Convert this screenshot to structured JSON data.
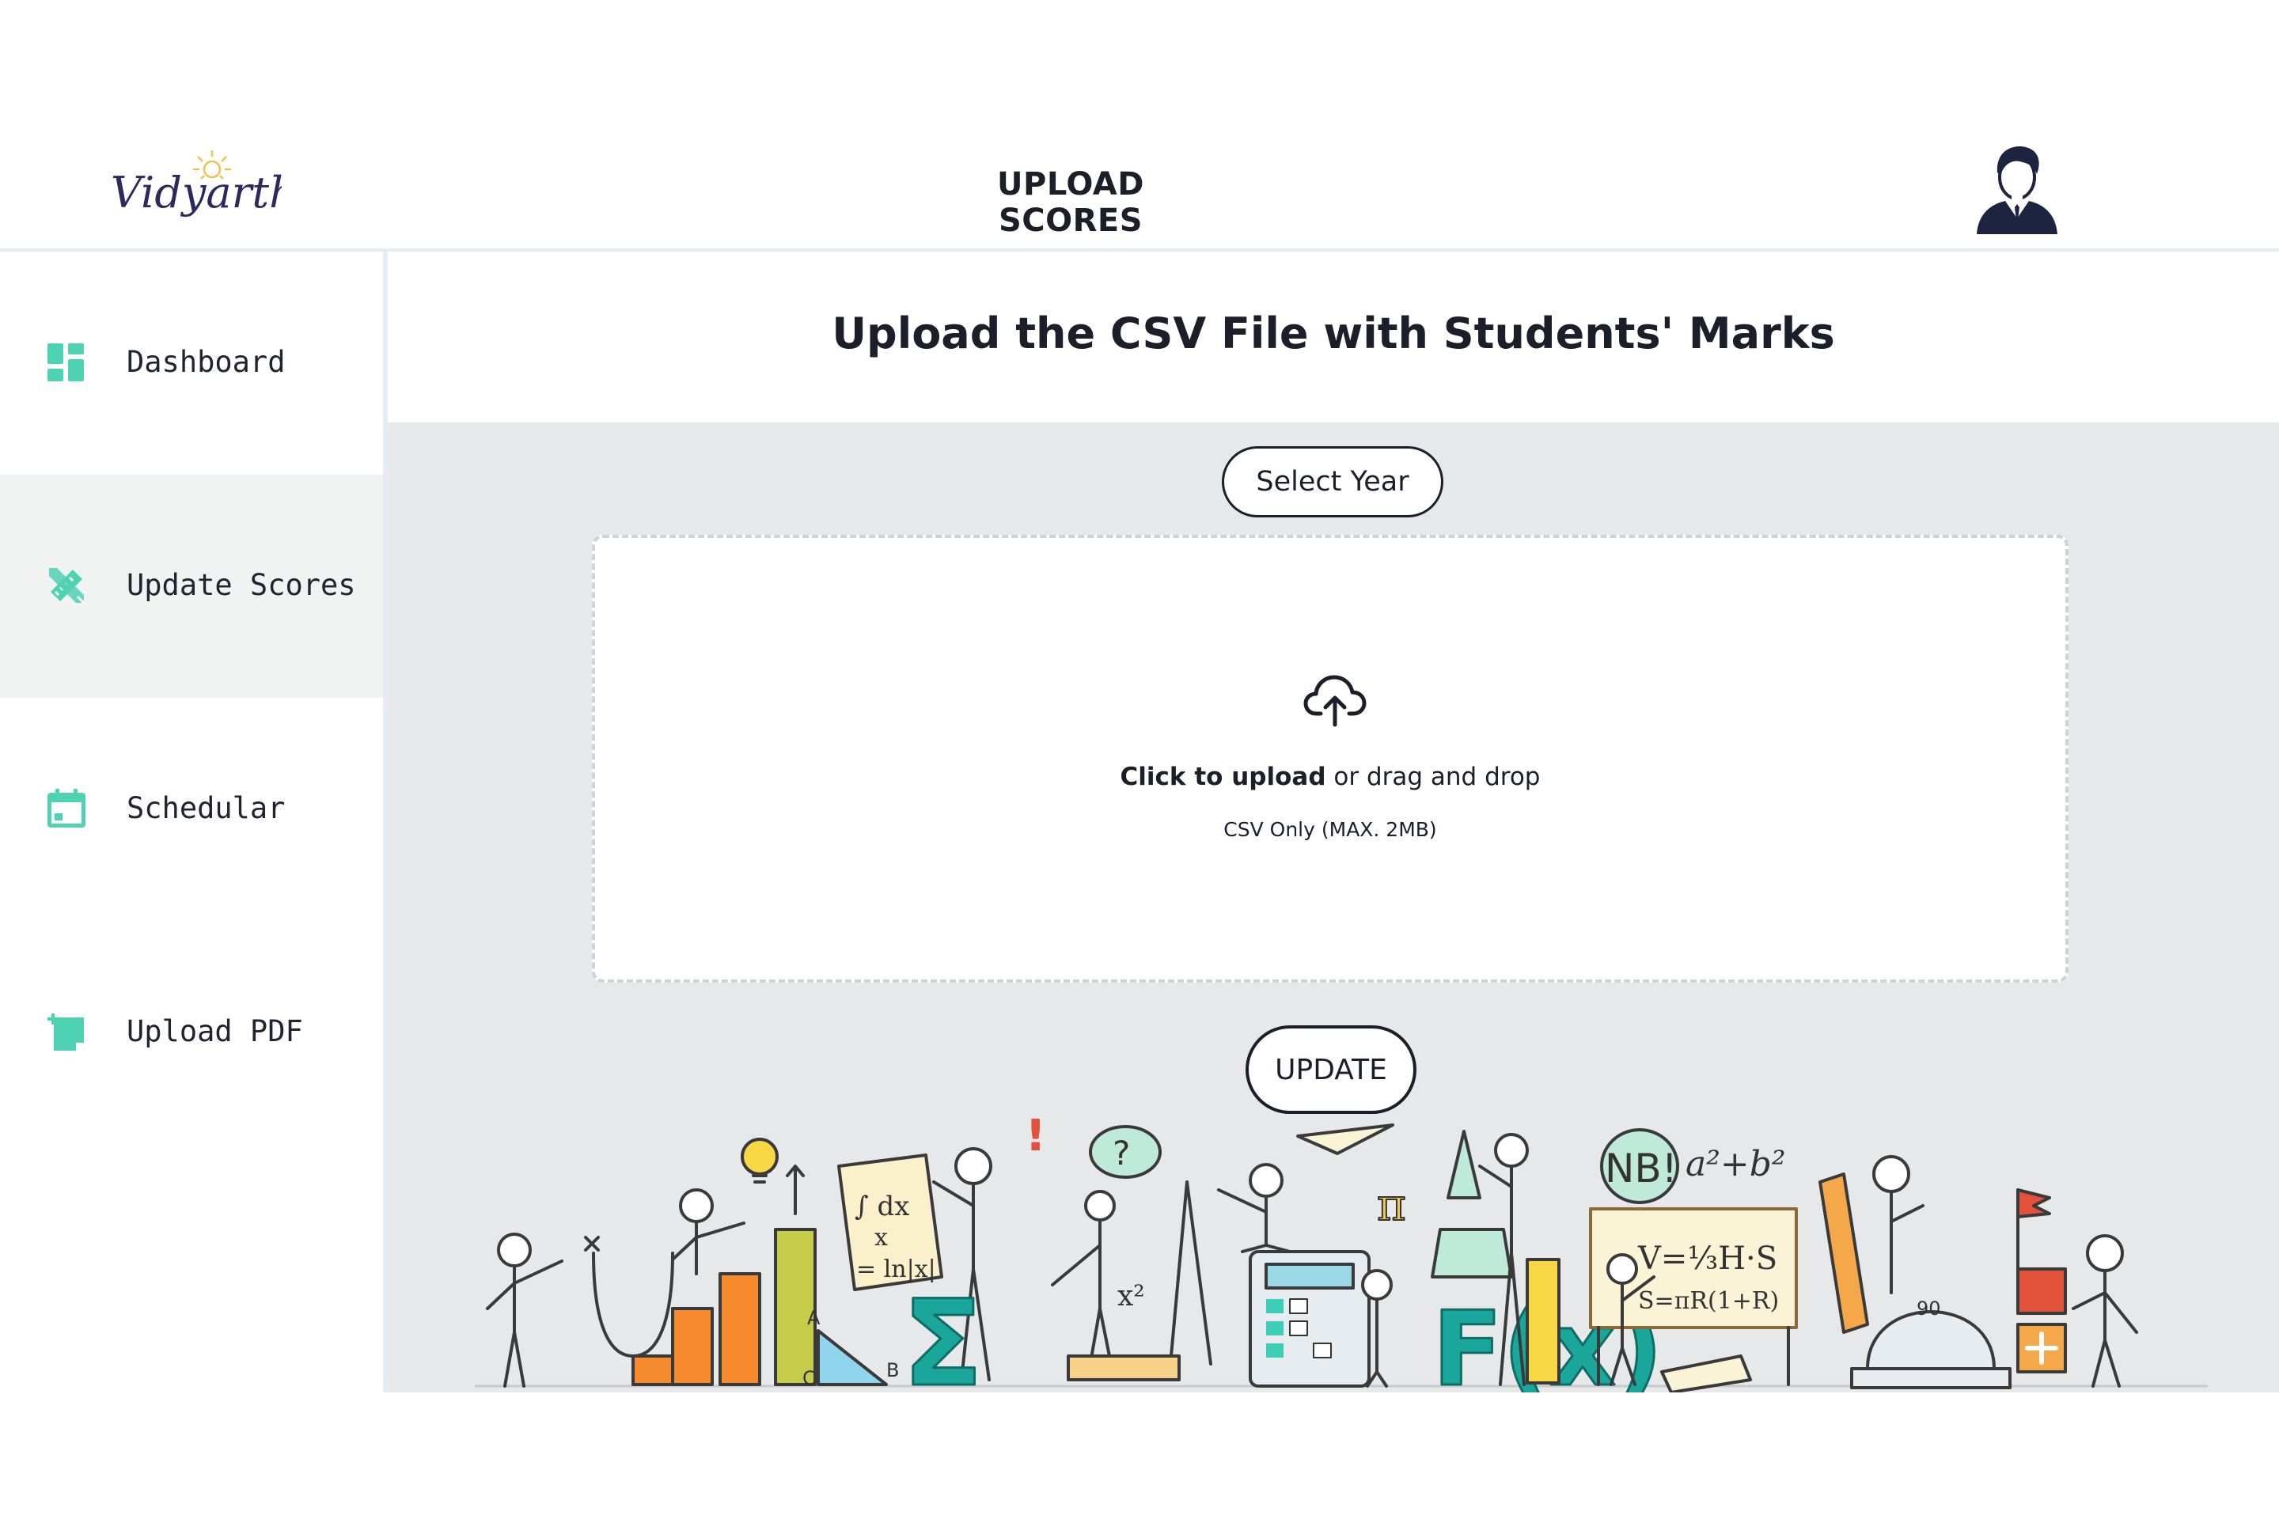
{
  "brand": {
    "logo_text": "Vidyarthi"
  },
  "header": {
    "title": "UPLOAD SCORES"
  },
  "sidebar": {
    "items": [
      {
        "label": "Dashboard",
        "icon": "dashboard-icon",
        "active": false
      },
      {
        "label": "Update Scores",
        "icon": "pencil-ruler-icon",
        "active": true
      },
      {
        "label": "Schedular",
        "icon": "calendar-icon",
        "active": false
      },
      {
        "label": "Upload PDF",
        "icon": "add-note-icon",
        "active": false
      }
    ]
  },
  "main": {
    "title": "Upload the CSV File with Students' Marks",
    "year_select_label": "Select Year",
    "dropzone": {
      "icon": "cloud-upload-icon",
      "click_text": "Click to upload",
      "rest_text": " or drag and drop",
      "hint": "CSV Only (MAX. 2MB)"
    },
    "update_label": "UPDATE",
    "illustration_labels": {
      "integral_top": "∫ dx",
      "integral_denominator": "x",
      "integral_result": "= ln|x|",
      "pi": "π",
      "sigma": "Σ",
      "fx": "F(x)",
      "xsq": "x²",
      "nb": "NB!",
      "ab": "a²+b²",
      "v": "V=⅓H·S",
      "s": "S=πR(1+R)",
      "protractor": "90",
      "question": "?",
      "exclaim": "!",
      "tri_a": "A",
      "tri_b": "B",
      "tri_c": "C",
      "x_axis": "X"
    }
  },
  "colors": {
    "accent": "#4fd1b3",
    "text": "#1b1f2a",
    "content_bg": "#e7e8ea",
    "active_bg": "#f1f2f2"
  }
}
